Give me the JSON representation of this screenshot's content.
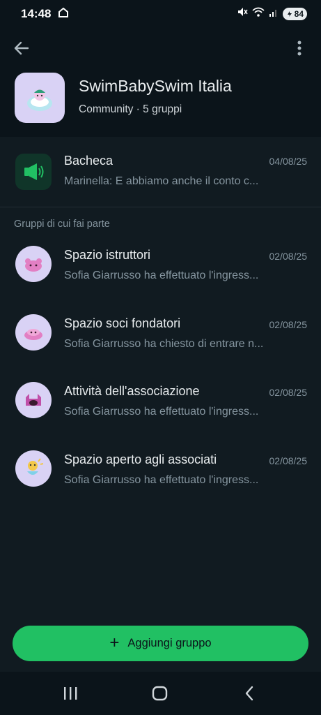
{
  "status_bar": {
    "time": "14:48",
    "battery": "84"
  },
  "community": {
    "name": "SwimBabySwim Italia",
    "subtitle": "Community · 5 gruppi"
  },
  "announcement": {
    "title": "Bacheca",
    "date": "04/08/25",
    "preview": "Marinella: E abbiamo anche il conto c..."
  },
  "section_label": "Gruppi di cui fai parte",
  "groups": [
    {
      "title": "Spazio istruttori",
      "date": "02/08/25",
      "preview": "Sofia Giarrusso ha effettuato l'ingress..."
    },
    {
      "title": "Spazio soci fondatori",
      "date": "02/08/25",
      "preview": "Sofia Giarrusso ha chiesto di entrare n..."
    },
    {
      "title": "Attività dell'associazione",
      "date": "02/08/25",
      "preview": "Sofia Giarrusso ha effettuato l'ingress..."
    },
    {
      "title": "Spazio aperto agli associati",
      "date": "02/08/25",
      "preview": "Sofia Giarrusso ha effettuato l'ingress..."
    }
  ],
  "add_button": {
    "plus": "+",
    "label": "Aggiungi gruppo"
  },
  "icons": {
    "back": "arrow-left-icon",
    "more": "more-vertical-icon",
    "announce": "megaphone-icon",
    "nav_recents": "recents-icon",
    "nav_home": "home-icon",
    "nav_back": "chevron-left-icon"
  },
  "colors": {
    "accent": "#21c063",
    "background": "#111b21",
    "header": "#0b141a",
    "avatar_bg": "#d9d2f5"
  }
}
